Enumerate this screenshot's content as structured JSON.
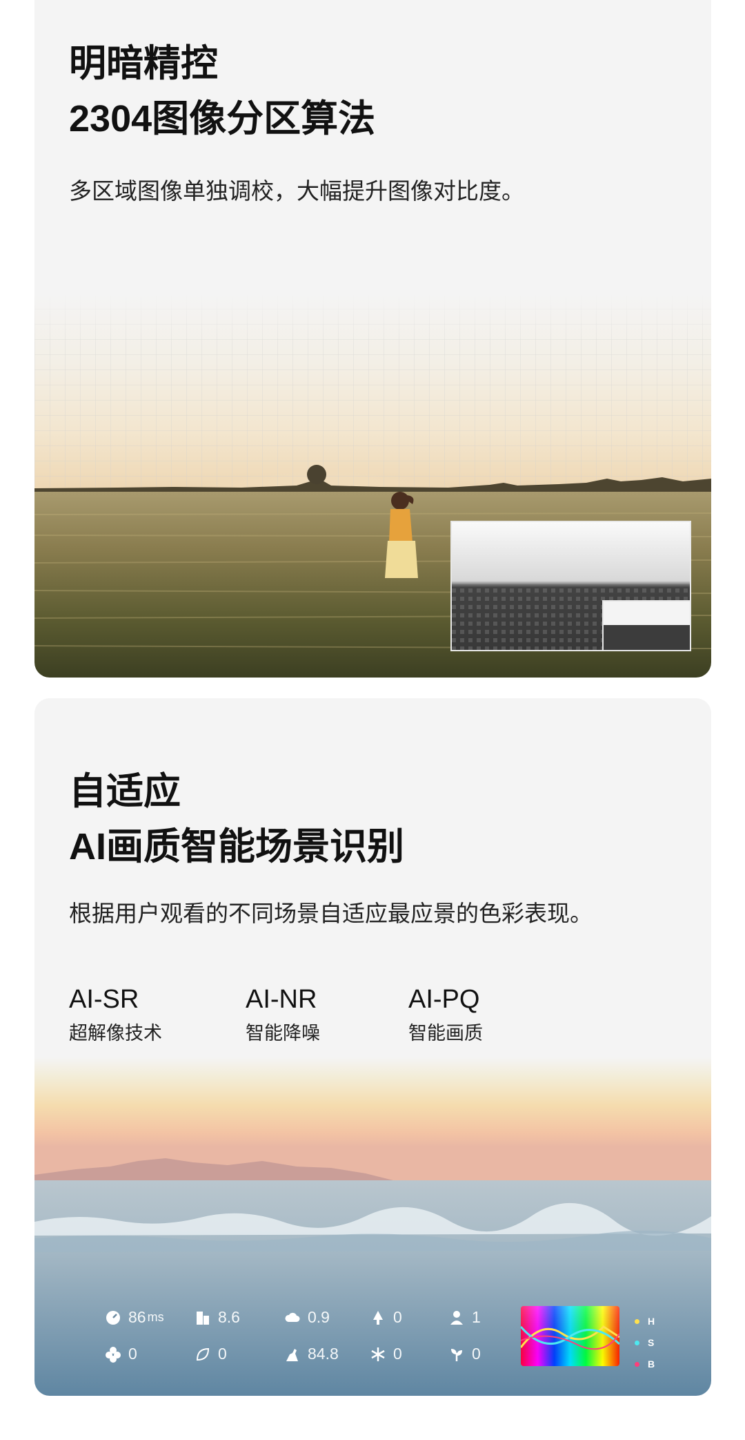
{
  "section1": {
    "title_line1": "明暗精控",
    "title_line2": "2304图像分区算法",
    "description": "多区域图像单独调校，大幅提升图像对比度。"
  },
  "section2": {
    "title_line1": "自适应",
    "title_line2": "AI画质智能场景识别",
    "description": "根据用户观看的不同场景自适应最应景的色彩表现。",
    "features": [
      {
        "code": "AI-SR",
        "name": "超解像技术"
      },
      {
        "code": "AI-NR",
        "name": "智能降噪"
      },
      {
        "code": "AI-PQ",
        "name": "智能画质"
      }
    ],
    "stats": {
      "latency": {
        "value": "86",
        "unit": "ms",
        "icon": "gauge-icon"
      },
      "building": {
        "value": "8.6",
        "icon": "building-icon"
      },
      "cloud": {
        "value": "0.9",
        "icon": "cloud-icon"
      },
      "tree": {
        "value": "0",
        "icon": "tree-icon"
      },
      "person": {
        "value": "1",
        "icon": "person-icon"
      },
      "flower": {
        "value": "0",
        "icon": "flower-icon"
      },
      "leaf": {
        "value": "0",
        "icon": "leaf-icon"
      },
      "animal": {
        "value": "84.8",
        "icon": "animal-icon"
      },
      "snow": {
        "value": "0",
        "icon": "snowflake-icon"
      },
      "plant": {
        "value": "0",
        "icon": "plant-icon"
      }
    },
    "hsb_legend": [
      {
        "label": "H",
        "color": "#ffe14d"
      },
      {
        "label": "S",
        "color": "#4de8f0"
      },
      {
        "label": "B",
        "color": "#ff3d7a"
      }
    ]
  }
}
